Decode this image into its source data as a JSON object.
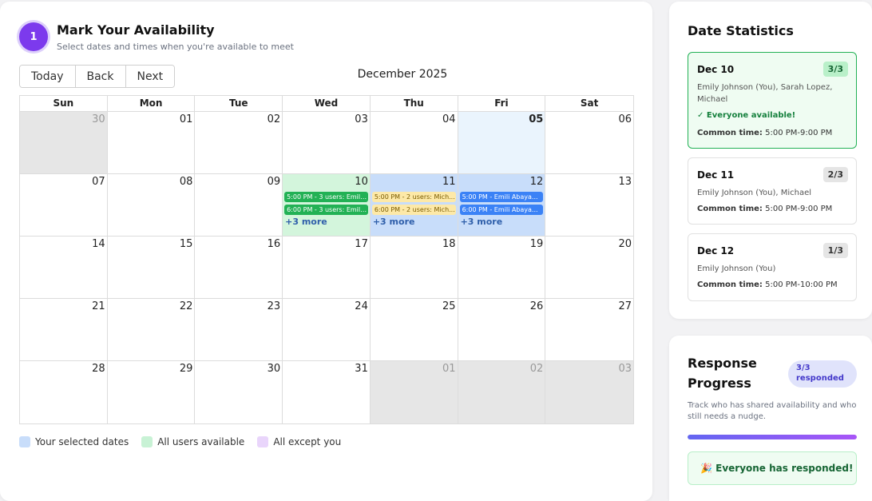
{
  "header": {
    "step": "1",
    "title": "Mark Your Availability",
    "subtitle": "Select dates and times when you're available to meet"
  },
  "nav": {
    "today": "Today",
    "back": "Back",
    "next": "Next"
  },
  "calendar": {
    "month_label": "December 2025",
    "weekdays": [
      "Sun",
      "Mon",
      "Tue",
      "Wed",
      "Thu",
      "Fri",
      "Sat"
    ],
    "days": [
      {
        "num": "30",
        "state": "off"
      },
      {
        "num": "01",
        "state": ""
      },
      {
        "num": "02",
        "state": ""
      },
      {
        "num": "03",
        "state": ""
      },
      {
        "num": "04",
        "state": ""
      },
      {
        "num": "05",
        "state": "today"
      },
      {
        "num": "06",
        "state": ""
      },
      {
        "num": "07",
        "state": ""
      },
      {
        "num": "08",
        "state": ""
      },
      {
        "num": "09",
        "state": ""
      },
      {
        "num": "10",
        "state": "all",
        "events": [
          {
            "text": "5:00 PM - 3 users: Emili...",
            "color": "green"
          },
          {
            "text": "6:00 PM - 3 users: Emili...",
            "color": "green"
          }
        ],
        "more": "+3 more"
      },
      {
        "num": "11",
        "state": "sel",
        "events": [
          {
            "text": "5:00 PM - 2 users: Mich...",
            "color": "yellow"
          },
          {
            "text": "6:00 PM - 2 users: Mich...",
            "color": "yellow"
          }
        ],
        "more": "+3 more"
      },
      {
        "num": "12",
        "state": "sel",
        "events": [
          {
            "text": "5:00 PM - Emili Abaya...",
            "color": "blue"
          },
          {
            "text": "6:00 PM - Emili Abaya...",
            "color": "blue"
          }
        ],
        "more": "+3 more"
      },
      {
        "num": "13",
        "state": ""
      },
      {
        "num": "14",
        "state": ""
      },
      {
        "num": "15",
        "state": ""
      },
      {
        "num": "16",
        "state": ""
      },
      {
        "num": "17",
        "state": ""
      },
      {
        "num": "18",
        "state": ""
      },
      {
        "num": "19",
        "state": ""
      },
      {
        "num": "20",
        "state": ""
      },
      {
        "num": "21",
        "state": ""
      },
      {
        "num": "22",
        "state": ""
      },
      {
        "num": "23",
        "state": ""
      },
      {
        "num": "24",
        "state": ""
      },
      {
        "num": "25",
        "state": ""
      },
      {
        "num": "26",
        "state": ""
      },
      {
        "num": "27",
        "state": ""
      },
      {
        "num": "28",
        "state": ""
      },
      {
        "num": "29",
        "state": ""
      },
      {
        "num": "30",
        "state": ""
      },
      {
        "num": "31",
        "state": ""
      },
      {
        "num": "01",
        "state": "off"
      },
      {
        "num": "02",
        "state": "off"
      },
      {
        "num": "03",
        "state": "off"
      }
    ]
  },
  "legend": [
    {
      "label": "Your selected dates",
      "color": "#c8ddfa"
    },
    {
      "label": "All users available",
      "color": "#c8f2d5"
    },
    {
      "label": "All except you",
      "color": "#e9d5fb"
    }
  ],
  "stats": {
    "title": "Date Statistics",
    "items": [
      {
        "date": "Dec 10",
        "count": "3/3",
        "names": "Emily Johnson (You), Sarah Lopez, Michael",
        "avail": "✓ Everyone available!",
        "common_label": "Common time:",
        "common_value": " 5:00 PM-9:00 PM"
      },
      {
        "date": "Dec 11",
        "count": "2/3",
        "names": "Emily Johnson (You), Michael",
        "common_label": "Common time:",
        "common_value": " 5:00 PM-9:00 PM"
      },
      {
        "date": "Dec 12",
        "count": "1/3",
        "names": "Emily Johnson (You)",
        "common_label": "Common time:",
        "common_value": " 5:00 PM-10:00 PM"
      }
    ]
  },
  "progress": {
    "title_line1": "Response",
    "title_line2": "Progress",
    "badge_line1": "3/3",
    "badge_line2": "responded",
    "description": "Track who has shared availability and who still needs a nudge.",
    "fraction": 1.0,
    "done_message": "🎉 Everyone has responded!"
  }
}
